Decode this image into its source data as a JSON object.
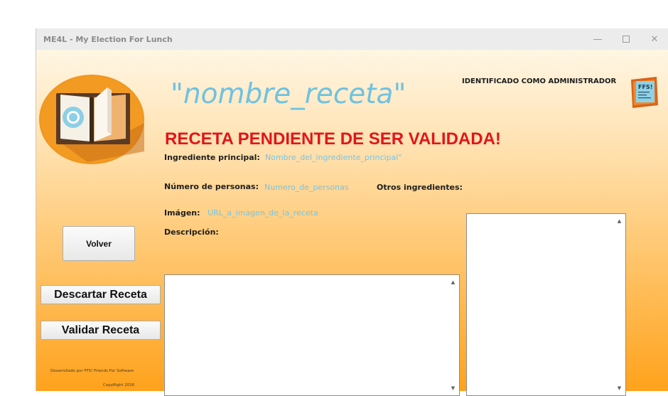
{
  "window": {
    "title": "ME4L - My Election For Lunch",
    "controls": {
      "minimize": "—",
      "close": "✕"
    }
  },
  "header": {
    "recipe_name": "\"nombre_receta\"",
    "admin_status": "IDENTIFICADO COMO ADMINISTRADOR",
    "pending_message": "RECETA PENDIENTE DE SER VALIDADA!",
    "ffs_logo_text": "FFS!"
  },
  "fields": {
    "main_ingredient": {
      "label": "Ingrediente principal:",
      "value": "Nombre_del_ingrediente_principal\""
    },
    "servings": {
      "label": "Número de personas:",
      "value": "Numero_de_personas"
    },
    "other_ingredients": {
      "label": "Otros ingredientes:",
      "value": ""
    },
    "image": {
      "label": "Imágen:",
      "value": "URL_a_imagen_de_la_receta"
    },
    "description": {
      "label": "Descripción:",
      "value": ""
    }
  },
  "buttons": {
    "back": "Volver",
    "discard": "Descartar Receta",
    "validate": "Validar Receta"
  },
  "footer": {
    "developer": "Desarrollado por FFS! Friends For Software",
    "copyright": "CopyRight 2016"
  },
  "colors": {
    "recipe_name": "#6fc2e0",
    "field_values": "#7ac5e4",
    "pending_heading": "#e2151a",
    "gradient_top": "#fff6e4",
    "gradient_bottom": "#ffa21c"
  },
  "icons": {
    "app_logo": "open-book-with-fried-egg-logo",
    "company_logo": "ffs-book-logo",
    "scroll_up": "chevron-up-icon",
    "scroll_down": "chevron-down-icon"
  }
}
